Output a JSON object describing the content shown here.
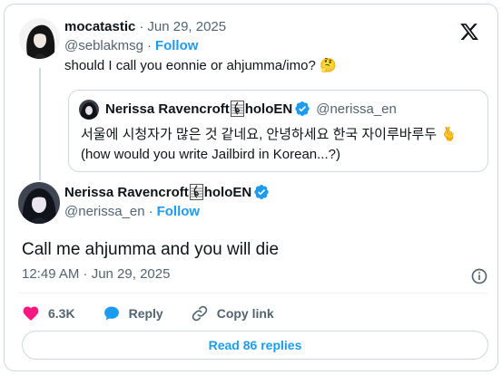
{
  "reply_to": {
    "display_name": "mocatastic",
    "separator": "·",
    "date": "Jun 29, 2025",
    "handle": "@seblakmsg",
    "follow_label": "Follow",
    "text": "should I call you eonnie or ahjumma/imo? 🤔",
    "avatar_icon": "avatar-girl"
  },
  "quoted": {
    "display_name": "Nerissa Ravencroft",
    "name_suffix": "holoEN",
    "handle": "@nerissa_en",
    "line1": "서울에 시청자가 많은 것 같네요, 안녕하세요 한국 자이루바루두 🫰",
    "line2": "(how would you write Jailbird in Korean...?)",
    "avatar_icon": "avatar-nerissa"
  },
  "main": {
    "display_name": "Nerissa Ravencroft",
    "name_suffix": "holoEN",
    "handle": "@nerissa_en",
    "separator": "·",
    "follow_label": "Follow",
    "text": "Call me ahjumma and you will die",
    "timestamp": "12:49 AM · Jun 29, 2025",
    "avatar_icon": "avatar-nerissa"
  },
  "actions": {
    "likes": "6.3K",
    "reply_label": "Reply",
    "copy_link_label": "Copy link"
  },
  "read_replies_label": "Read 86 replies",
  "colors": {
    "accent": "#1d9bf0",
    "like": "#f91880",
    "muted": "#536471",
    "border": "#cfd9de"
  }
}
